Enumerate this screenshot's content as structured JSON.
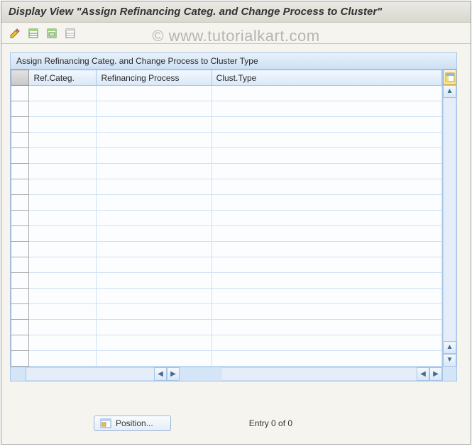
{
  "title": "Display View \"Assign Refinancing Categ. and Change Process to Cluster\"",
  "watermark": "© www.tutorialkart.com",
  "panel": {
    "title": "Assign Refinancing Categ. and Change Process to Cluster Type",
    "columns": {
      "c1": "Ref.Categ.",
      "c2": "Refinancing Process",
      "c3": "Clust.Type"
    },
    "row_count": 18
  },
  "footer": {
    "position_label": "Position...",
    "entry_text": "Entry 0 of 0"
  },
  "icons": {
    "pencil": "pencil-icon",
    "sheet1": "select-all-icon",
    "sheet2": "select-block-icon",
    "sheet3": "deselect-all-icon",
    "config": "table-settings-icon"
  }
}
